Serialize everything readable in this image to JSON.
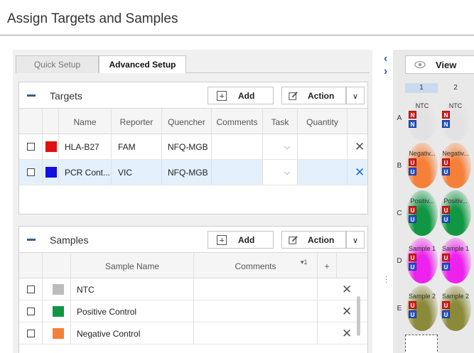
{
  "page": {
    "title": "Assign Targets and Samples"
  },
  "tabs": [
    {
      "label": "Quick Setup",
      "active": false
    },
    {
      "label": "Advanced Setup",
      "active": true
    }
  ],
  "targets": {
    "title": "Targets",
    "add_label": "Add",
    "action_label": "Action",
    "columns": [
      "Name",
      "Reporter",
      "Quencher",
      "Comments",
      "Task",
      "Quantity"
    ],
    "rows": [
      {
        "color": "#e01010",
        "name": "HLA-B27",
        "reporter": "FAM",
        "quencher": "NFQ-MGB",
        "comments": "",
        "task": "",
        "quantity": "",
        "selected": false
      },
      {
        "color": "#1010e0",
        "name": "PCR Cont...",
        "reporter": "VIC",
        "quencher": "NFQ-MGB",
        "comments": "",
        "task": "",
        "quantity": "",
        "selected": true
      }
    ]
  },
  "samples": {
    "title": "Samples",
    "add_label": "Add",
    "action_label": "Action",
    "columns": [
      "Sample Name",
      "Comments"
    ],
    "sort_indicator": "▾1",
    "add_col": "+",
    "rows": [
      {
        "color": "#bcbcbc",
        "name": "NTC"
      },
      {
        "color": "#119744",
        "name": "Positive Control"
      },
      {
        "color": "#f4803a",
        "name": "Negative Control"
      }
    ]
  },
  "plate": {
    "view_label": "View",
    "columns": [
      "1",
      "2"
    ],
    "rows": [
      {
        "letter": "A",
        "label": "NTC",
        "tag": "N",
        "color": "#e2e2e2"
      },
      {
        "letter": "B",
        "label": "Negativ...",
        "tag": "U",
        "color": "#f4803a"
      },
      {
        "letter": "C",
        "label": "Positiv...",
        "tag": "U",
        "color": "#119744"
      },
      {
        "letter": "D",
        "label": "Sample 1",
        "tag": "U",
        "color": "#ee22ee"
      },
      {
        "letter": "E",
        "label": "Sample 2",
        "tag": "U",
        "color": "#8a8a3a"
      }
    ]
  },
  "colors": {
    "accent": "#2f5f97",
    "delete_selected": "#1f6fd8"
  },
  "icons": [
    "minus-icon",
    "plus-box-icon",
    "edit-icon",
    "chevron-down-icon",
    "close-icon",
    "eye-icon",
    "chevron-left-icon",
    "chevron-right-icon"
  ]
}
